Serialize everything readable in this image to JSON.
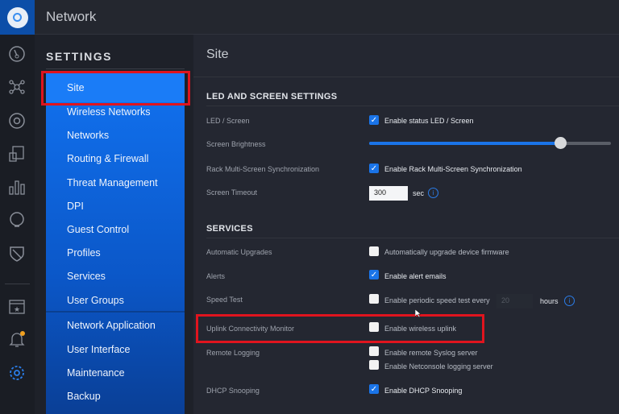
{
  "header": {
    "title": "Network"
  },
  "iconbar": [
    "dashboard-icon",
    "topology-icon",
    "devices-icon",
    "clients-icon",
    "statistics-icon",
    "insights-icon",
    "shield-icon",
    "events-icon",
    "alerts-icon",
    "settings-icon"
  ],
  "sidebar": {
    "heading": "SETTINGS",
    "items": [
      {
        "label": "Site"
      },
      {
        "label": "Wireless Networks"
      },
      {
        "label": "Networks"
      },
      {
        "label": "Routing & Firewall"
      },
      {
        "label": "Threat Management"
      },
      {
        "label": "DPI"
      },
      {
        "label": "Guest Control"
      },
      {
        "label": "Profiles"
      },
      {
        "label": "Services"
      },
      {
        "label": "User Groups"
      },
      {
        "label": "Network Application"
      },
      {
        "label": "User Interface"
      },
      {
        "label": "Maintenance"
      },
      {
        "label": "Backup"
      }
    ],
    "selected": "Site"
  },
  "main": {
    "title": "Site",
    "led": {
      "heading": "LED AND SCREEN SETTINGS",
      "led_label": "LED / Screen",
      "led_cb": "Enable status LED / Screen",
      "led_checked": true,
      "brightness_label": "Screen Brightness",
      "brightness_value": 0.79,
      "rack_label": "Rack Multi-Screen Synchronization",
      "rack_cb": "Enable Rack Multi-Screen Synchronization",
      "rack_checked": true,
      "timeout_label": "Screen Timeout",
      "timeout_value": "300",
      "timeout_unit": "sec"
    },
    "services": {
      "heading": "SERVICES",
      "auto_label": "Automatic Upgrades",
      "auto_cb": "Automatically upgrade device firmware",
      "alerts_label": "Alerts",
      "alerts_cb": "Enable alert emails",
      "speed_label": "Speed Test",
      "speed_cb": "Enable periodic speed test every",
      "speed_value": "20",
      "speed_unit": "hours",
      "uplink_label": "Uplink Connectivity Monitor",
      "uplink_cb": "Enable wireless uplink",
      "remote_label": "Remote Logging",
      "syslog_cb": "Enable remote Syslog server",
      "netconsole_cb": "Enable Netconsole logging server",
      "dhcp_label": "DHCP Snooping",
      "dhcp_cb": "Enable DHCP Snooping"
    }
  },
  "colors": {
    "accent": "#1a74e8",
    "highlight": "#e0141e"
  }
}
